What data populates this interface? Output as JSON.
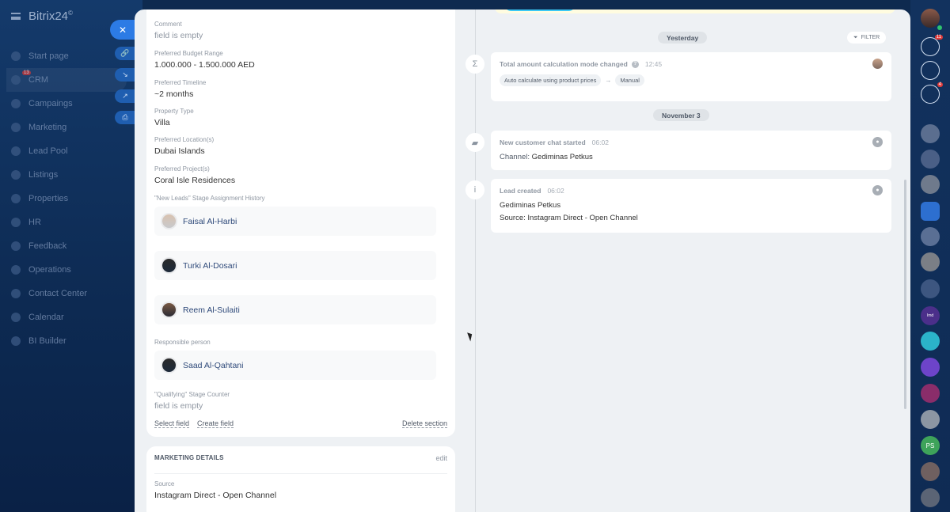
{
  "app": {
    "name": "Bitrix24",
    "suffix": "©"
  },
  "sidebar": {
    "items": [
      {
        "label": "Start page"
      },
      {
        "label": "CRM",
        "badge": "13"
      },
      {
        "label": "Campaings"
      },
      {
        "label": "Marketing"
      },
      {
        "label": "Lead Pool"
      },
      {
        "label": "Listings"
      },
      {
        "label": "Properties"
      },
      {
        "label": "HR"
      },
      {
        "label": "Feedback"
      },
      {
        "label": "Operations"
      },
      {
        "label": "Contact Center"
      },
      {
        "label": "Calendar"
      },
      {
        "label": "BI Builder"
      }
    ]
  },
  "slider_buttons": {
    "close": "✕",
    "link": "🔗",
    "open": "↘",
    "external": "↗",
    "print": "⎙"
  },
  "fields": {
    "comment": {
      "label": "Comment",
      "value": "field is empty"
    },
    "budget": {
      "label": "Preferred Budget Range",
      "value": "1.000.000 - 1.500.000 AED"
    },
    "timeline": {
      "label": "Preferred Timeline",
      "value": "~2 months"
    },
    "property_type": {
      "label": "Property Type",
      "value": "Villa"
    },
    "location": {
      "label": "Preferred Location(s)",
      "value": "Dubai Islands"
    },
    "project": {
      "label": "Preferred Project(s)",
      "value": "Coral Isle Residences"
    },
    "history": {
      "label": "\"New Leads\" Stage Assignment History",
      "users": [
        "Faisal Al-Harbi",
        "Turki Al-Dosari",
        "Reem Al-Sulaiti"
      ]
    },
    "responsible": {
      "label": "Responsible person",
      "user": "Saad Al-Qahtani"
    },
    "qualifying": {
      "label": "\"Qualifying\" Stage Counter",
      "value": "field is empty"
    }
  },
  "section_links": {
    "select_field": "Select field",
    "create_field": "Create field",
    "delete_section": "Delete section"
  },
  "marketing": {
    "title": "MARKETING DETAILS",
    "edit": "edit",
    "source_label": "Source",
    "source_value": "Instagram Direct - Open Channel"
  },
  "timeline": {
    "filter": "FILTER",
    "date1": "Yesterday",
    "date2": "November 3",
    "event1": {
      "title": "Total amount calculation mode changed",
      "time": "12:45",
      "from": "Auto calculate using product prices",
      "arrow": "→",
      "to": "Manual"
    },
    "event2": {
      "title": "New customer chat started",
      "time": "06:02",
      "channel_label": "Channel:",
      "channel_value": "Gediminas Petkus"
    },
    "event3": {
      "title": "Lead created",
      "time": "06:02",
      "name": "Gediminas Petkus",
      "source": "Source: Instagram Direct - Open Channel"
    }
  },
  "right_panel": {
    "notifications_badge": "11",
    "chat_badge": "4",
    "ps_initials": "PS",
    "purple_label": "Imd"
  }
}
